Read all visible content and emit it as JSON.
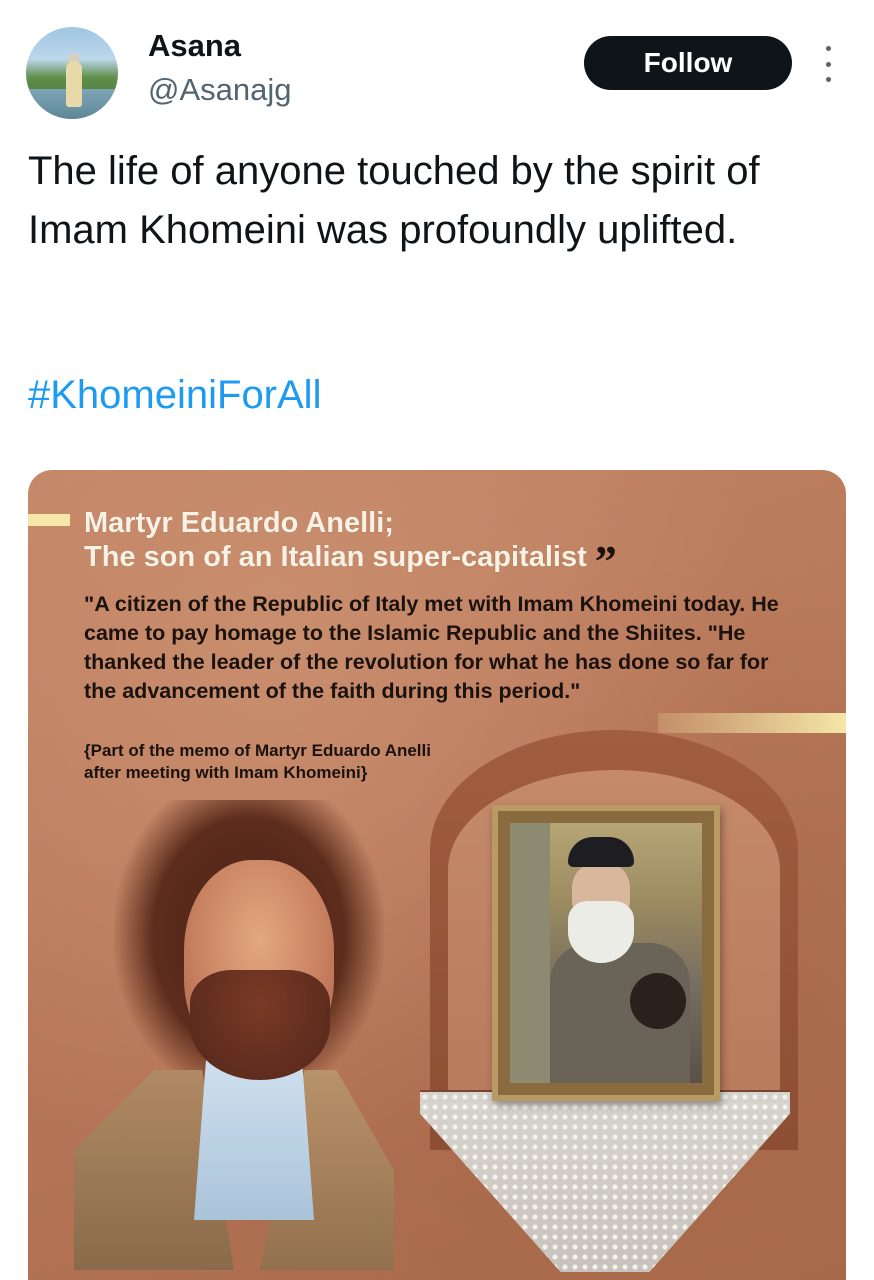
{
  "author": {
    "display_name": "Asana",
    "handle": "@Asanajg"
  },
  "actions": {
    "follow_label": "Follow"
  },
  "tweet": {
    "text": "The life of anyone touched by the spirit of Imam Khomeini was profoundly uplifted.",
    "hashtag": "#KhomeiniForAll"
  },
  "media": {
    "headline_line1": "Martyr Eduardo Anelli;",
    "headline_line2": "The son of an Italian super-capitalist",
    "quote_mark": "”",
    "quote": "\"A citizen of the Republic of Italy met with Imam Khomeini today. He came to pay homage to the Islamic Republic and the Shiites. \"He thanked the leader of the revolution for what he has done so far for the advancement of the faith during this period.\"",
    "memo_line1": "{Part of the memo of Martyr Eduardo Anelli",
    "memo_line2": "after meeting with Imam Khomeini}"
  },
  "colors": {
    "link": "#1d9bf0",
    "text_primary": "#0f1419",
    "text_secondary": "#536471",
    "button_bg": "#0f1419",
    "accent_bar": "#f4e7a7"
  },
  "icons": {
    "more": "more-vertical-icon"
  }
}
